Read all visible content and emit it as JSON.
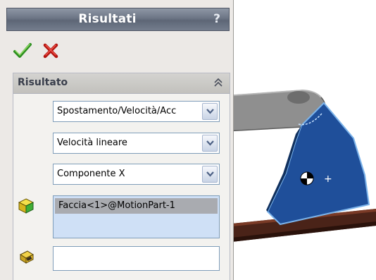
{
  "panel": {
    "title": "Risultati",
    "help_label": "?",
    "ok_icon": "checkmark-icon",
    "cancel_icon": "x-icon"
  },
  "group": {
    "title": "Risultato",
    "collapse_icon": "double-chevron-up-icon",
    "result_category": "Spostamento/Velocità/Acc",
    "result_subcategory": "Velocità lineare",
    "result_component": "Componente X",
    "selected_faces": [
      "Faccia<1>@MotionPart-1"
    ],
    "face_selector_icon": "face-cube-icon",
    "reference_part_icon": "part-component-icon",
    "reference_part_value": ""
  },
  "viewport": {
    "model": "motion-linkage-model",
    "colors": {
      "link": "#1f4f9a",
      "link_edge": "#7bb3ea",
      "arm": "#8f8f8f",
      "rail": "#4a2318"
    }
  }
}
